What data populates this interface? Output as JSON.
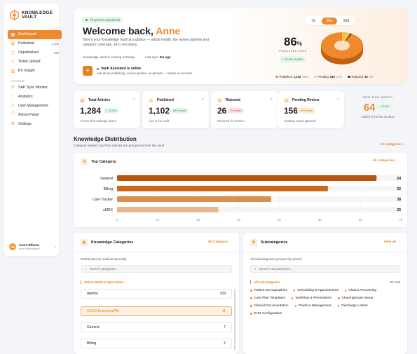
{
  "app": {
    "logo_line1": "KNOWLEDGE",
    "logo_line2": "VAULT"
  },
  "sidebar": {
    "items": [
      {
        "label": "Dashboard",
        "icon": "grid-icon",
        "count": "",
        "active": true
      },
      {
        "label": "Published",
        "icon": "doc-icon",
        "count": "1,102",
        "active": false
      },
      {
        "label": "Unpublished",
        "icon": "doc-off-icon",
        "count": "156",
        "active": false
      },
      {
        "label": "Ticket Upload",
        "icon": "upload-icon",
        "count": "",
        "active": false
      },
      {
        "label": "KV Insight",
        "icon": "chart-icon",
        "count": "",
        "active": false
      }
    ],
    "system_label": "SYSTEM",
    "system_items": [
      {
        "label": "SAP Sync Monitor",
        "icon": "sync-icon"
      },
      {
        "label": "Analytics",
        "icon": "analytics-icon"
      },
      {
        "label": "User Management",
        "icon": "users-icon"
      },
      {
        "label": "Admin Panel",
        "icon": "shield-icon"
      },
      {
        "label": "Settings",
        "icon": "gear-icon"
      }
    ],
    "user": {
      "initials": "AE",
      "name": "Anne Ellison",
      "email": "anne.ellison@gm..."
    }
  },
  "hero": {
    "status": "All systems operational",
    "welcome_prefix": "Welcome back,",
    "user_name": "Anne",
    "subtitle": "Here's your Knowledge Vault at a glance — article health, the review pipeline and category coverage, all in one place.",
    "running": "Knowledge Vault is running normally.",
    "last_sync_label": "Last sync",
    "last_sync_value": "2m ago",
    "assistant_title": "Vault Assistant is online",
    "assistant_sub": "Ask about publishing, review pipeline or uploads — replies in seconds.",
    "ranges": [
      "7d",
      "30d",
      "90d"
    ],
    "range_selected": "30d",
    "rate_value": "86",
    "rate_unit": "%",
    "rate_label": "PUBLISHED RATE",
    "rate_delta": "↑ 12.4%  vs prev.",
    "legend": [
      {
        "label": "Published",
        "value": "1,102",
        "pct": "86%",
        "color": "#f0892d"
      },
      {
        "label": "Pending",
        "value": "156",
        "pct": "12%",
        "color": "#f7c04a"
      },
      {
        "label": "Rejected",
        "value": "26",
        "pct": "2%",
        "color": "#3a3a44"
      }
    ]
  },
  "stats": [
    {
      "title": "Total Articles",
      "value": "1,284",
      "badge": "↑ 12.4%",
      "badge_class": "b-green",
      "foot": "Across all knowledge bases",
      "icon": "book-icon"
    },
    {
      "title": "Published",
      "value": "1,102",
      "badge": "86% share",
      "badge_class": "b-green",
      "foot": "Live in the vault",
      "icon": "check-circle-icon"
    },
    {
      "title": "Rejected",
      "value": "26",
      "badge": "2% share",
      "badge_class": "b-red",
      "foot": "Returned for revision",
      "icon": "x-circle-icon"
    },
    {
      "title": "Pending Review",
      "value": "156",
      "badge": "10% share",
      "badge_class": "b-yel",
      "foot": "Awaiting expert approval",
      "icon": "clock-icon"
    }
  ],
  "new_month": {
    "heading": "NEW THIS MONTH",
    "value": "64",
    "badge": "↑ 12.4%",
    "foot": "Added in the last 30 days"
  },
  "distribution": {
    "title": "Knowledge Distribution",
    "subtitle": "Category leaders and how articles are grouped across the vault",
    "link": "All categories →",
    "top_category_title": "Top Category",
    "top_category_link": "All categories →"
  },
  "chart_data": {
    "type": "bar",
    "orientation": "horizontal",
    "title": "Top Category",
    "categories": [
      "General",
      "Billing",
      "Care Tracker",
      "eMDX"
    ],
    "values": [
      64,
      52,
      38,
      25
    ],
    "xlim": [
      0,
      70
    ],
    "xticks": [
      0,
      10,
      20,
      30,
      40,
      50,
      60,
      70
    ],
    "colors": [
      "#b8560f",
      "#c96a1c",
      "#d98f4d",
      "#e8b98e"
    ],
    "grid": true
  },
  "knowledge_categories": {
    "title": "Knowledge Categories",
    "link": "All Category →",
    "desc": "Distribution by medical specialty",
    "search_placeholder": "Search categories...",
    "select_label": "Select Medical Specialties",
    "items": [
      {
        "label": "Aprima",
        "count": "109",
        "selected": false
      },
      {
        "label": "USOS EnterprisePM",
        "count": "11",
        "selected": true
      },
      {
        "label": "General",
        "count": "7",
        "selected": false
      },
      {
        "label": "Billing",
        "count": "2",
        "selected": false
      }
    ]
  },
  "subcategories": {
    "title": "Subcategories",
    "link": "View all →",
    "desc": "All subcategories grouped by parent",
    "search_placeholder": "Search subcategories...",
    "select_label": "All subcategories",
    "total": "96 total",
    "chips": [
      "Patient Demographics",
      "Scheduling & Appointments",
      "Claims Processing",
      "Care Plan Templates",
      "Workflow & Permissions",
      "Clearinghouse Setup",
      "Clinical Documentation",
      "Practice Management",
      "Discharge Letters",
      "EHR Configuration"
    ]
  }
}
